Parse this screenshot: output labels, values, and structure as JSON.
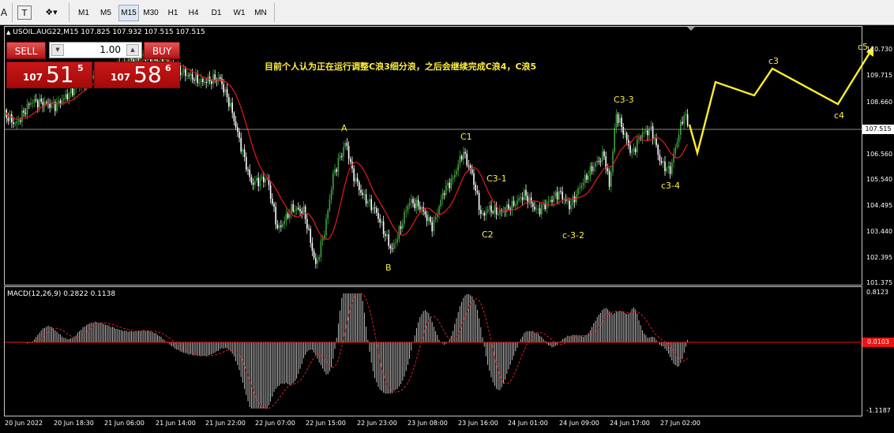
{
  "toolbar": {
    "font_icon": "A",
    "text_icon": "T",
    "objects_icon": "shapes-icon",
    "timeframes": [
      "M1",
      "M5",
      "M15",
      "M30",
      "H1",
      "H4",
      "D1",
      "W1",
      "MN"
    ],
    "active_timeframe": "M15"
  },
  "chart": {
    "header": "USOIL.AUG22,M15  107.825 107.932 107.515 107.515",
    "comment": "目前个人认为正在运行调整C浪3细分浪，之后会继续完成C浪4，C浪5",
    "price_label": "107.515",
    "y_labels": [
      "110.730",
      "109.715",
      "108.660",
      "107.515",
      "106.560",
      "105.540",
      "104.495",
      "103.440",
      "102.395",
      "101.375"
    ],
    "x_labels": [
      "20 Jun 2022",
      "20 Jun 18:30",
      "21 Jun 06:00",
      "21 Jun 14:00",
      "21 Jun 22:00",
      "22 Jun 07:00",
      "22 Jun 15:00",
      "22 Jun 23:00",
      "23 Jun 08:00",
      "23 Jun 16:00",
      "24 Jun 01:00",
      "24 Jun 09:00",
      "24 Jun 17:00",
      "27 Jun 02:00"
    ],
    "annotations": [
      "A",
      "B",
      "C1",
      "C2",
      "C3-1",
      "c-3-2",
      "C3-3",
      "c3-4",
      "c3",
      "c4",
      "c5"
    ],
    "colors": {
      "bull": "#3fa33f",
      "bear": "#ffffff",
      "ma": "#e51b1b",
      "projection": "#ffef2a",
      "annotation": "#ffef3c"
    }
  },
  "trade_panel": {
    "sell_label": "SELL",
    "buy_label": "BUY",
    "lot": "1.00",
    "sell_prefix": "107",
    "sell_big": "51",
    "sell_sup": "5",
    "buy_prefix": "107",
    "buy_big": "58",
    "buy_sup": "6"
  },
  "macd": {
    "header": "MACD(12,26,9) 0.2822 0.1138",
    "y_top": "0.8123",
    "y_bottom": "-1.1187",
    "zero_label": "0.0103"
  }
}
